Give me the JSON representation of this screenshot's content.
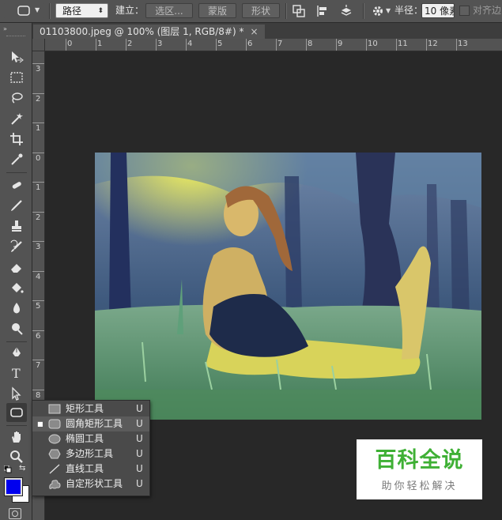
{
  "options_bar": {
    "mode_select": "路径",
    "build_label": "建立：",
    "selection_btn": "选区...",
    "mask_btn": "蒙版",
    "shape_btn": "形状",
    "radius_label": "半径：",
    "radius_value": "10 像素",
    "align_edges_label": "对齐边"
  },
  "document_tab": {
    "title": "01103800.jpeg @ 100% (图层 1, RGB/8#) *",
    "close": "×"
  },
  "rulers": {
    "horizontal": [
      "1",
      "0",
      "1",
      "2",
      "3",
      "4",
      "5",
      "6",
      "7",
      "8",
      "9",
      "10",
      "11",
      "12",
      "13"
    ],
    "vertical": [
      "3",
      "2",
      "1",
      "0",
      "1",
      "2",
      "3",
      "4",
      "5",
      "6",
      "7",
      "8"
    ]
  },
  "shape_flyout": {
    "items": [
      {
        "icon": "rectangle-icon",
        "label": "矩形工具",
        "key": "U",
        "selected": false
      },
      {
        "icon": "rounded-rectangle-icon",
        "label": "圆角矩形工具",
        "key": "U",
        "selected": true
      },
      {
        "icon": "ellipse-icon",
        "label": "椭圆工具",
        "key": "U",
        "selected": false
      },
      {
        "icon": "polygon-icon",
        "label": "多边形工具",
        "key": "U",
        "selected": false
      },
      {
        "icon": "line-icon",
        "label": "直线工具",
        "key": "U",
        "selected": false
      },
      {
        "icon": "custom-shape-icon",
        "label": "自定形状工具",
        "key": "U",
        "selected": false
      }
    ],
    "selected_marker": "■"
  },
  "colors": {
    "foreground": "#0000ee",
    "background": "#ffffff",
    "accent_green": "#3fb035"
  },
  "watermark": {
    "title": "百科全说",
    "subtitle": "助你轻松解决"
  }
}
